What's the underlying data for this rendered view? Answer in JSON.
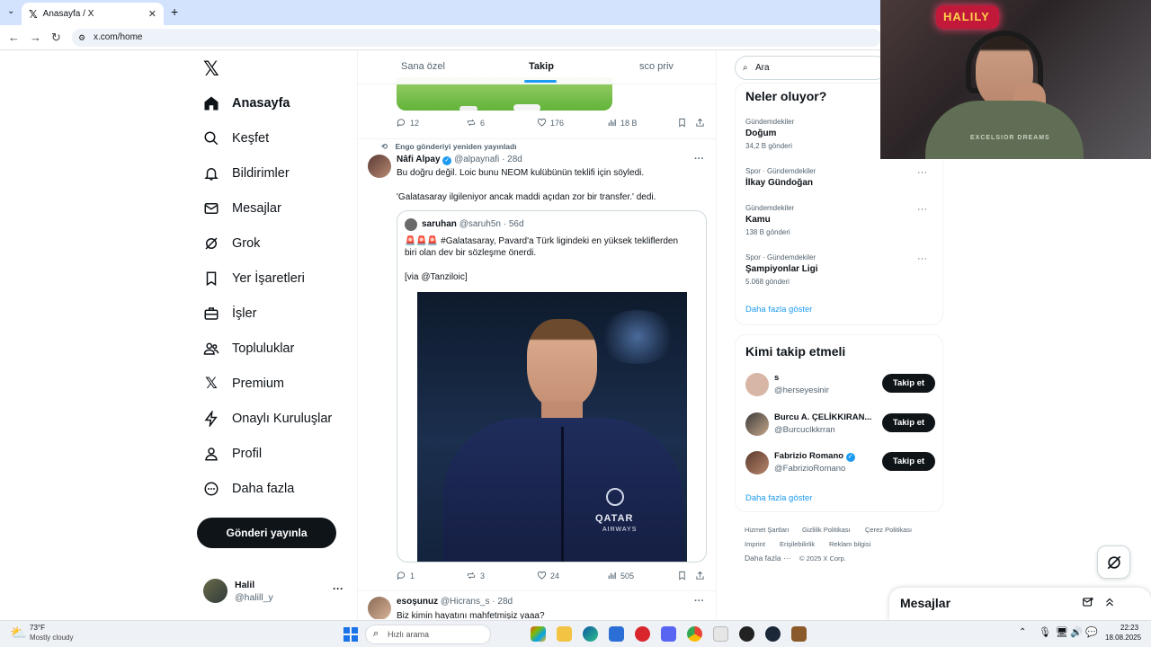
{
  "browser": {
    "tab_title": "Anasayfa / X",
    "url": "x.com/home"
  },
  "nav": {
    "items": [
      {
        "label": "Anasayfa",
        "icon": "home-icon"
      },
      {
        "label": "Keşfet",
        "icon": "search-icon"
      },
      {
        "label": "Bildirimler",
        "icon": "bell-icon"
      },
      {
        "label": "Mesajlar",
        "icon": "mail-icon"
      },
      {
        "label": "Grok",
        "icon": "grok-icon"
      },
      {
        "label": "Yer İşaretleri",
        "icon": "bookmark-icon"
      },
      {
        "label": "İşler",
        "icon": "briefcase-icon"
      },
      {
        "label": "Topluluklar",
        "icon": "people-icon"
      },
      {
        "label": "Premium",
        "icon": "x-icon"
      },
      {
        "label": "Onaylı Kuruluşlar",
        "icon": "lightning-icon"
      },
      {
        "label": "Profil",
        "icon": "person-icon"
      },
      {
        "label": "Daha fazla",
        "icon": "more-circle-icon"
      }
    ],
    "post_button": "Gönderi yayınla",
    "user": {
      "name": "Halil",
      "handle": "@halill_y"
    }
  },
  "feed": {
    "tabs": [
      "Sana özel",
      "Takip",
      "sco priv"
    ],
    "active_tab": "Takip",
    "tweet0_stats": {
      "replies": "12",
      "reposts": "6",
      "likes": "176",
      "views": "18 B"
    },
    "tweet1": {
      "repost_note": "Engo gönderiyi yeniden yayınladı",
      "name": "Nâfi Alpay",
      "handle": "@alpaynafi",
      "time": "· 28d",
      "text1": "Bu doğru değil. Loic bunu NEOM kulübünün teklifi için söyledi.",
      "text2": "'Galatasaray ilgileniyor ancak maddi açıdan zor bir transfer.' dedi.",
      "quote": {
        "name": "saruhan",
        "handle": "@saruh5n",
        "time": "· 56d",
        "text1": "🚨🚨🚨 #Galatasaray, Pavard'a Türk ligindeki en yüksek tekliflerden",
        "text2": "biri olan dev bir sözleşme önerdi.",
        "text3": "[via @Tanziloic]",
        "photo_text1": "QATAR",
        "photo_text2": "AIRWAYS"
      },
      "stats": {
        "replies": "1",
        "reposts": "3",
        "likes": "24",
        "views": "505"
      }
    },
    "tweet2": {
      "name": "esoşunuz",
      "handle": "@Hicrans_s",
      "time": "· 28d",
      "text": "Biz kimin hayatını mahfetmişiz yaaa?"
    }
  },
  "sidebar": {
    "search_placeholder": "Ara",
    "trends_title": "Neler oluyor?",
    "trends": [
      {
        "meta": "Gündemdekiler",
        "name": "Doğum",
        "count": "34,2 B gönderi"
      },
      {
        "meta": "Spor · Gündemdekiler",
        "name": "İlkay Gündoğan",
        "count": ""
      },
      {
        "meta": "Gündemdekiler",
        "name": "Kamu",
        "count": "138 B gönderi"
      },
      {
        "meta": "Spor · Gündemdekiler",
        "name": "Şampiyonlar Ligi",
        "count": "5.068 gönderi"
      }
    ],
    "trends_more": "Daha fazla göster",
    "follow_title": "Kimi takip etmeli",
    "follow": [
      {
        "name": "s",
        "handle": "@herseyesinir",
        "button": "Takip et"
      },
      {
        "name": "Burcu A. ÇELİKKIRAN...",
        "handle": "@Burcuclkkrran",
        "button": "Takip et"
      },
      {
        "name": "Fabrizio Romano",
        "handle": "@FabrizioRomano",
        "button": "Takip et"
      }
    ],
    "follow_more": "Daha fazla göster",
    "footer": [
      "Hizmet Şartları",
      "Gizlilik Politikası",
      "Çerez Politikası",
      "Imprint",
      "Erişilebilirlik",
      "Reklam bilgisi",
      "Daha fazla ···",
      "© 2025 X Corp."
    ]
  },
  "webcam": {
    "sign_text": "HALILY",
    "shirt_text": "EXCELSIOR DREAMS"
  },
  "messages_drawer": {
    "title": "Mesajlar"
  },
  "taskbar": {
    "weather_temp": "73°F",
    "weather_desc": "Mostly cloudy",
    "search_placeholder": "Hızlı arama",
    "time": "22:23",
    "date": "18.08.2025"
  },
  "colors": {
    "accent": "#1d9bf0",
    "text": "#0f1419",
    "muted": "#536471",
    "verified": "#1d9bf0"
  }
}
